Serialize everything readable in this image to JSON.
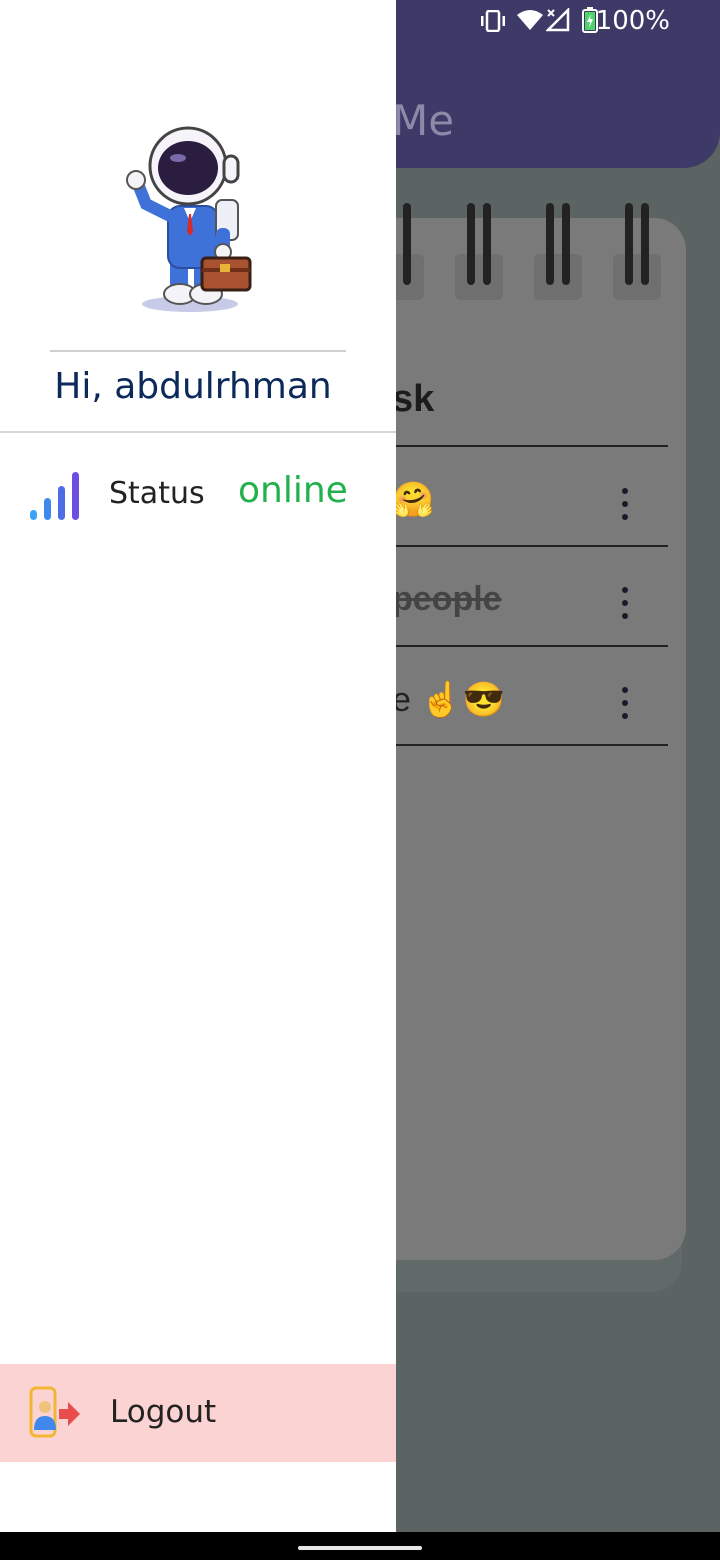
{
  "app": {
    "title_fragment": "Me"
  },
  "status_bar": {
    "battery_text": "100%",
    "icons": [
      "vibrate-icon",
      "wifi-icon",
      "no-signal-icon",
      "battery-charging-icon"
    ]
  },
  "background_list": {
    "header_fragment": "sk",
    "rows": [
      {
        "text": "🤗",
        "strikethrough": false
      },
      {
        "text": "people",
        "strikethrough": true
      },
      {
        "text": "e ☝️😎",
        "strikethrough": false
      }
    ]
  },
  "drawer": {
    "greeting": "Hi, abdulrhman",
    "status": {
      "label": "Status",
      "value": "online"
    },
    "logout_label": "Logout"
  },
  "colors": {
    "appbar": "#3d3a68",
    "online": "#22b14c",
    "greeting": "#0b2a5a",
    "logout_bg": "#fcd3d3"
  }
}
